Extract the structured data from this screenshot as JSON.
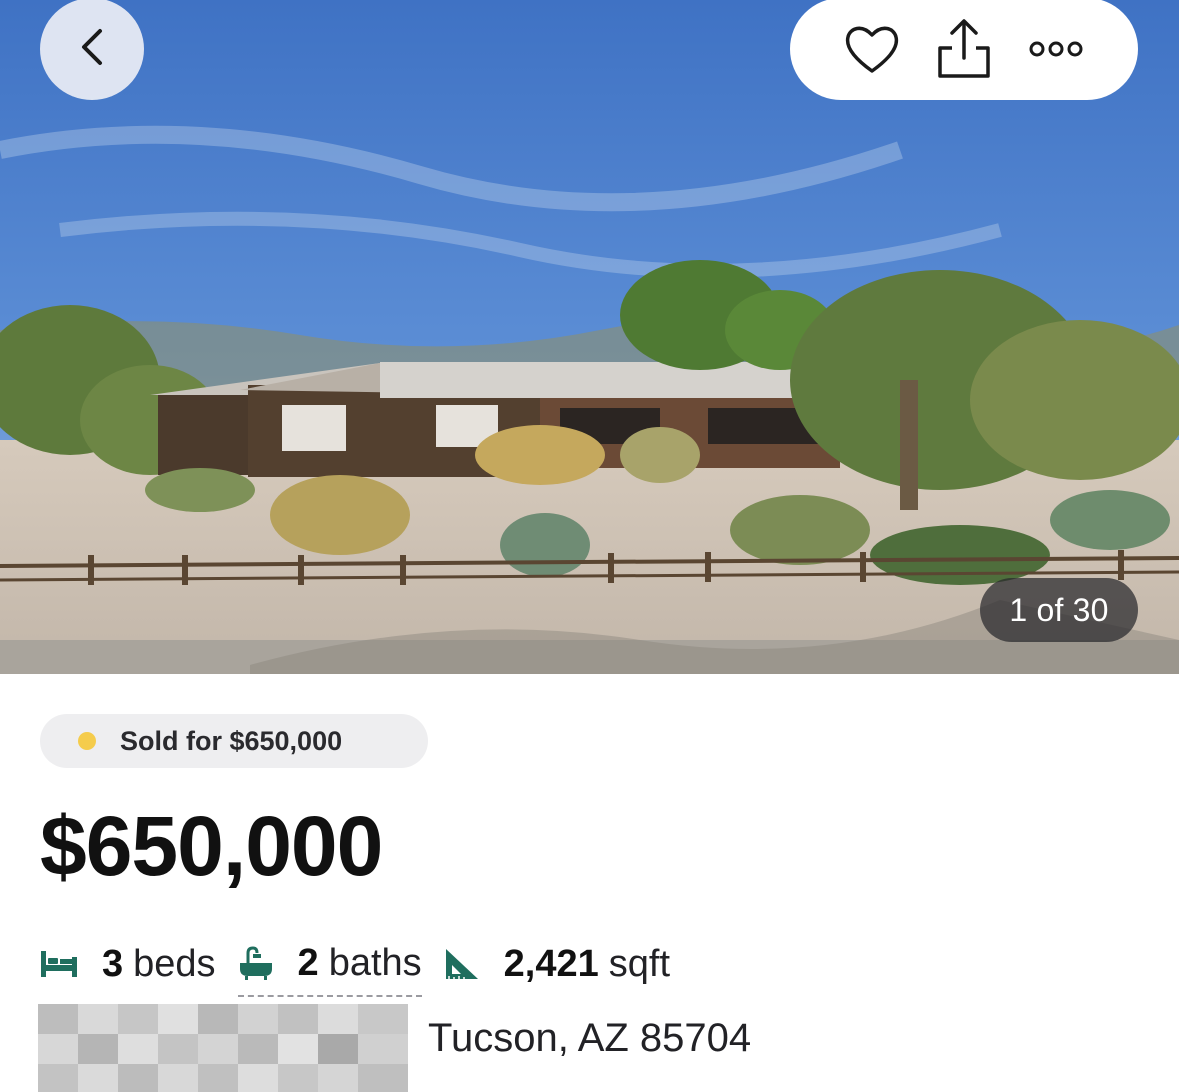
{
  "header": {
    "back_icon": "chevron-left-icon",
    "actions": [
      {
        "icon": "heart-icon"
      },
      {
        "icon": "share-icon"
      },
      {
        "icon": "more-icon"
      }
    ]
  },
  "gallery": {
    "counter": "1 of 30"
  },
  "listing": {
    "status": "Sold for $650,000",
    "status_color": "#f5cc4c",
    "price": "$650,000",
    "beds_num": "3",
    "beds_label": "beds",
    "baths_num": "2",
    "baths_label": "baths",
    "sqft_num": "2,421",
    "sqft_label": "sqft",
    "icon_color": "#1f6e5e",
    "city_line": "Tucson, AZ 85704"
  }
}
